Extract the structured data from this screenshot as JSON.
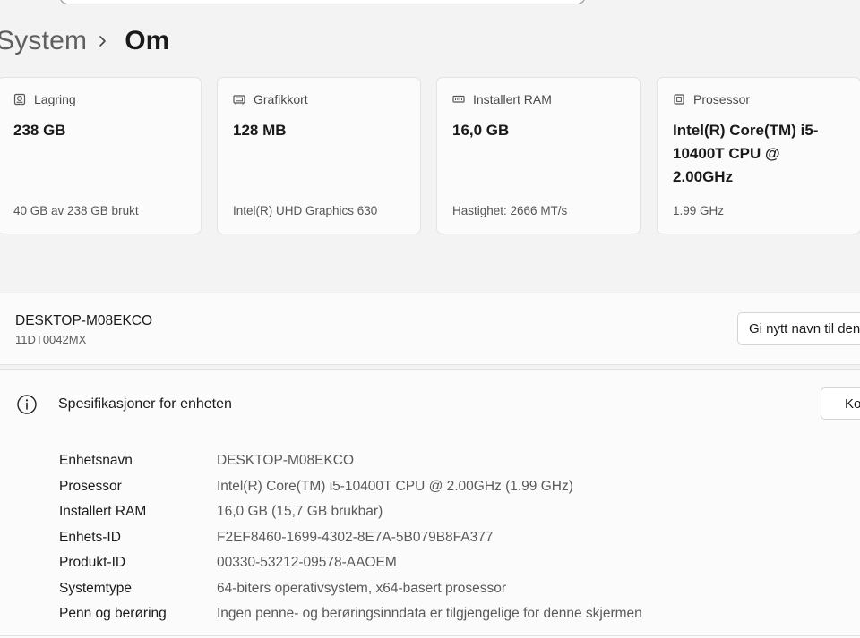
{
  "breadcrumb": {
    "parent": "System",
    "current": "Om"
  },
  "cards": [
    {
      "icon": "storage-drive-icon",
      "label": "Lagring",
      "value": "238 GB",
      "sub": "40 GB av 238 GB brukt"
    },
    {
      "icon": "graphics-card-icon",
      "label": "Grafikkort",
      "value": "128 MB",
      "sub": "Intel(R) UHD Graphics 630"
    },
    {
      "icon": "ram-icon",
      "label": "Installert RAM",
      "value": "16,0 GB",
      "sub": "Hastighet: 2666 MT/s"
    },
    {
      "icon": "processor-chip-icon",
      "label": "Prosessor",
      "value": "Intel(R) Core(TM) i5-10400T CPU @ 2.00GHz",
      "sub": "1.99 GHz"
    }
  ],
  "device": {
    "name": "DESKTOP-M08EKCO",
    "model": "11DT0042MX",
    "rename_label": "Gi nytt navn til denne PC-en"
  },
  "specs": {
    "title": "Spesifikasjoner for enheten",
    "copy_label": "Kopier",
    "rows": [
      {
        "label": "Enhetsnavn",
        "value": "DESKTOP-M08EKCO"
      },
      {
        "label": "Prosessor",
        "value": "Intel(R) Core(TM) i5-10400T CPU @ 2.00GHz (1.99 GHz)"
      },
      {
        "label": "Installert RAM",
        "value": "16,0 GB (15,7 GB brukbar)"
      },
      {
        "label": "Enhets-ID",
        "value": "F2EF8460-1699-4302-8E7A-5B079B8FA377"
      },
      {
        "label": "Produkt-ID",
        "value": "00330-53212-09578-AAOEM"
      },
      {
        "label": "Systemtype",
        "value": "64-biters operativsystem, x64-basert prosessor"
      },
      {
        "label": "Penn og berøring",
        "value": "Ingen penne- og berøringsinndata er tilgjengelige for denne skjermen"
      }
    ]
  }
}
